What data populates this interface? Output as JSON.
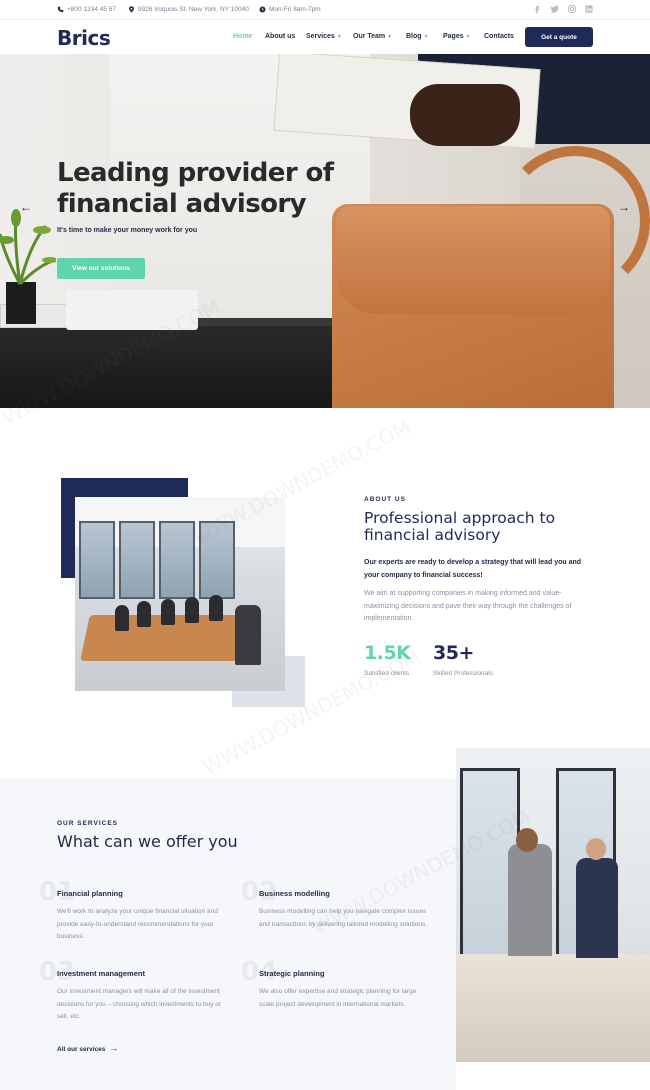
{
  "topbar": {
    "phone": "+800 1234 45 67",
    "address": "9926 Iroquois St. New York, NY 10040",
    "hours": "Mon-Fri 8am-7pm",
    "social_icons": [
      "facebook-icon",
      "twitter-icon",
      "instagram-icon",
      "linkedin-icon"
    ]
  },
  "header": {
    "logo": "Brics",
    "nav": [
      {
        "label": "Home",
        "active": true,
        "dropdown": false
      },
      {
        "label": "About us",
        "active": false,
        "dropdown": false
      },
      {
        "label": "Services",
        "active": false,
        "dropdown": true
      },
      {
        "label": "Our Team",
        "active": false,
        "dropdown": true
      },
      {
        "label": "Blog",
        "active": false,
        "dropdown": true
      },
      {
        "label": "Pages",
        "active": false,
        "dropdown": true
      },
      {
        "label": "Contacts",
        "active": false,
        "dropdown": false
      }
    ],
    "cta": "Get a quote"
  },
  "hero": {
    "title_line1": "Leading provider of",
    "title_line2": "financial advisory",
    "subtitle": "It's time to make your money work for you",
    "button": "View our solutions",
    "prev_arrow": "←",
    "next_arrow": "→"
  },
  "about": {
    "tag": "ABOUT US",
    "title": "Professional approach to financial advisory",
    "lead": "Our experts are ready to develop a strategy that will lead you and your company to financial success!",
    "body": "We aim at supporting companies in making informed and value-maximizing decisions and pave their way through the challenges of implementation.",
    "stats": [
      {
        "value": "1.5K",
        "label": "Satisfied clients",
        "color": "#5fd4ae"
      },
      {
        "value": "35+",
        "label": "Skilled Professionals",
        "color": "#1f2a5a"
      }
    ]
  },
  "services": {
    "tag": "OUR SERVICES",
    "title": "What can we offer you",
    "items": [
      {
        "num": "01",
        "title": "Financial planning",
        "text": "We'll work to analyze your unique financial situation and provide easy-to-understand recommendations for your business."
      },
      {
        "num": "02",
        "title": "Business modelling",
        "text": "Business modelling can help you navigate complex issues and transactions by delivering tailored modelling solutions."
      },
      {
        "num": "03",
        "title": "Investment management",
        "text": "Our investment managers will make all of the investment decisions for you – choosing which investments to buy or sell, etc."
      },
      {
        "num": "04",
        "title": "Strategic planning",
        "text": "We also offer expertise and strategic planning for large scale project development in international markets."
      }
    ],
    "link": "All our services",
    "link_arrow": "→"
  },
  "watermark": "WWW.DOWNDEMO.COM",
  "colors": {
    "accent": "#5fd4ae",
    "navy": "#1f2a5a"
  }
}
